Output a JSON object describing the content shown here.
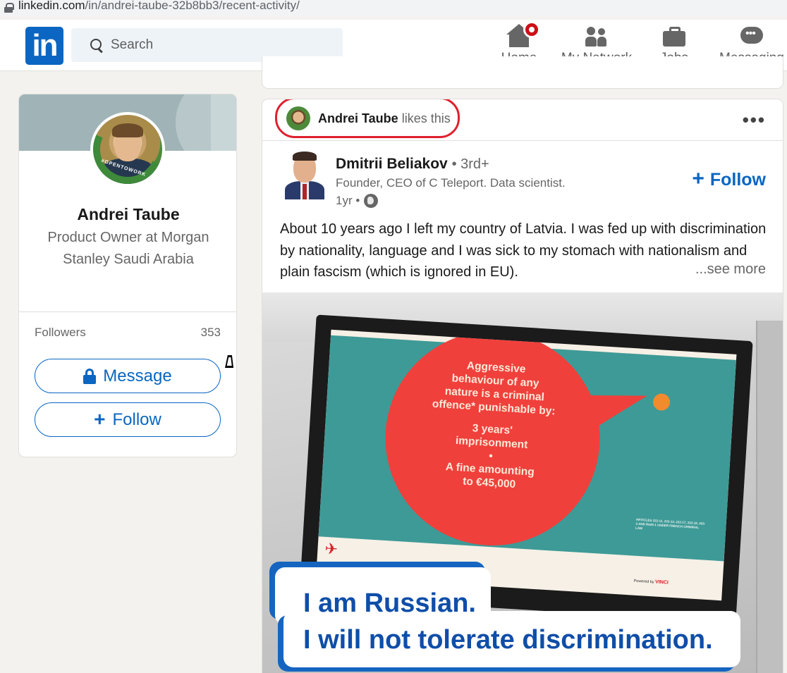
{
  "browser": {
    "url_domain": "linkedin.com",
    "url_path": "/in/andrei-taube-32b8bb3/recent-activity/"
  },
  "nav": {
    "logo_text": "in",
    "search_placeholder": "Search",
    "items": [
      {
        "label": "Home",
        "icon": "home-icon",
        "notification": true
      },
      {
        "label": "My Network",
        "icon": "people-icon"
      },
      {
        "label": "Jobs",
        "icon": "briefcase-icon"
      },
      {
        "label": "Messaging",
        "icon": "chat-icon"
      }
    ]
  },
  "profile": {
    "name": "Andrei Taube",
    "headline": "Product Owner at Morgan Stanley Saudi Arabia",
    "open_to_work_frame": "#OPENTOWORK",
    "followers_label": "Followers",
    "followers_count": "353",
    "message_label": "Message",
    "follow_label": "Follow"
  },
  "post": {
    "liker_name": "Andrei Taube",
    "liker_action": "likes this",
    "author_name": "Dmitrii Beliakov",
    "author_degree": "• 3rd+",
    "author_headline": "Founder, CEO of C Teleport. Data scientist.",
    "time": "1yr •",
    "follow_label": "Follow",
    "text": "About 10 years ago I left my country of Latvia. I was fed up with discrimination by nationality, language and I was sick to my stomach with nationalism and plain fascism (which is ignored in EU).",
    "see_more": "...see more",
    "image": {
      "screen_lines": [
        "Aggressive",
        "behaviour of any",
        "nature is a criminal",
        "offence* punishable by:",
        "3 years'",
        "imprisonment",
        "•",
        "A fine amounting",
        "to €45,000"
      ],
      "fine_print": "ARTICLES 222-11, 222-13, 222-17, 222-18, 433-3 AND R625-1 UNDER FRENCH CRIMINAL LAW",
      "footer_powered": "Powered by",
      "footer_brand": "VINCI",
      "caption_line1": "I am Russian.",
      "caption_line2": "I will not tolerate discrimination."
    }
  },
  "colors": {
    "linkedin_blue": "#0a66c2",
    "highlight_red": "#e0202e",
    "notification_red": "#cc1016"
  }
}
